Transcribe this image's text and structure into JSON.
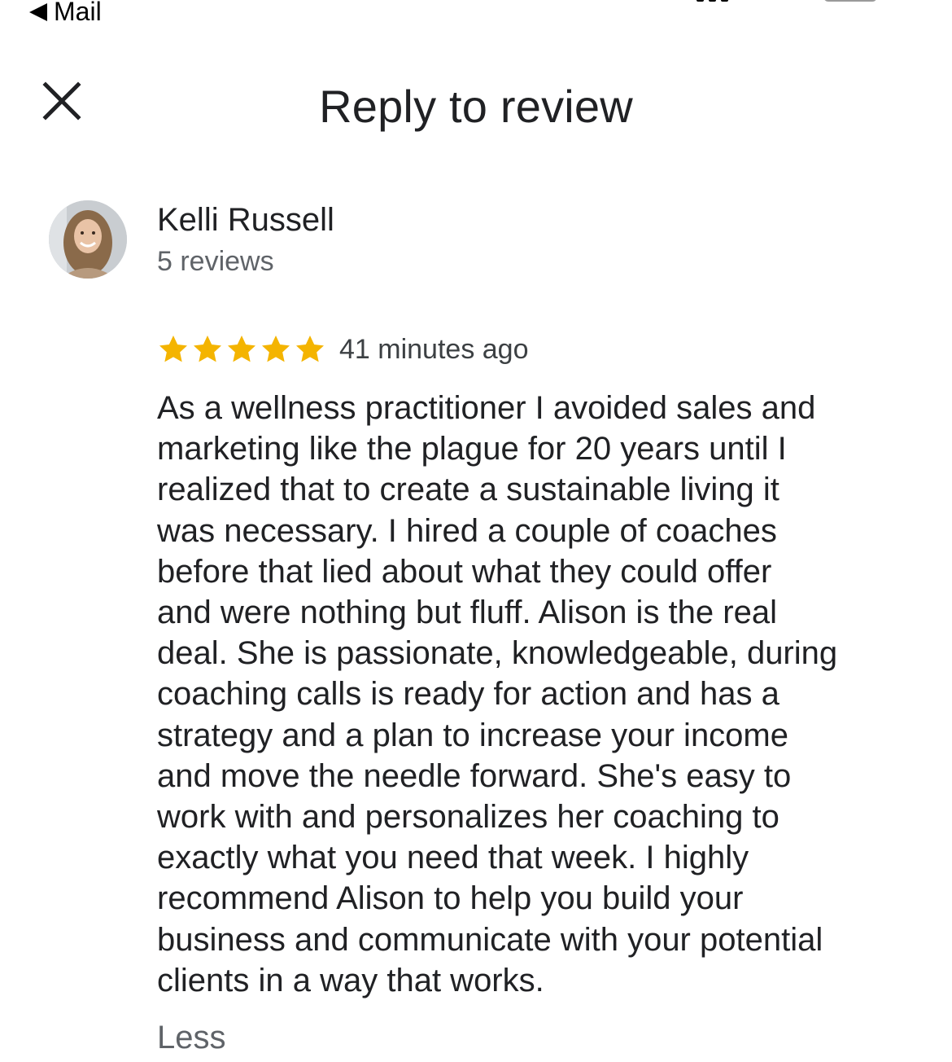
{
  "status_bar": {
    "back_app_label": "Mail"
  },
  "header": {
    "title": "Reply to review",
    "close_icon": "close-icon"
  },
  "reviewer": {
    "name": "Kelli Russell",
    "review_count": "5 reviews",
    "avatar": "avatar-photo"
  },
  "review": {
    "rating": 5,
    "rating_max": 5,
    "star_color": "#F4B400",
    "time_ago": "41 minutes ago",
    "text": "As a wellness practitioner I avoided sales and\nmarketing like the plague for 20 years until I\nrealized that to create a sustainable living it\nwas necessary. I hired a couple of coaches\nbefore that lied about what they could offer\nand were nothing but fluff. Alison is the real\ndeal. She is passionate, knowledgeable, during\ncoaching calls is ready for action and has a\nstrategy and a plan to increase your income\nand move the needle forward. She's easy to\nwork with and personalizes her coaching to\nexactly what you need that week. I highly\nrecommend Alison to help you build your\nbusiness and communicate with your potential\nclients in a way that works.",
    "collapse_label": "Less"
  }
}
